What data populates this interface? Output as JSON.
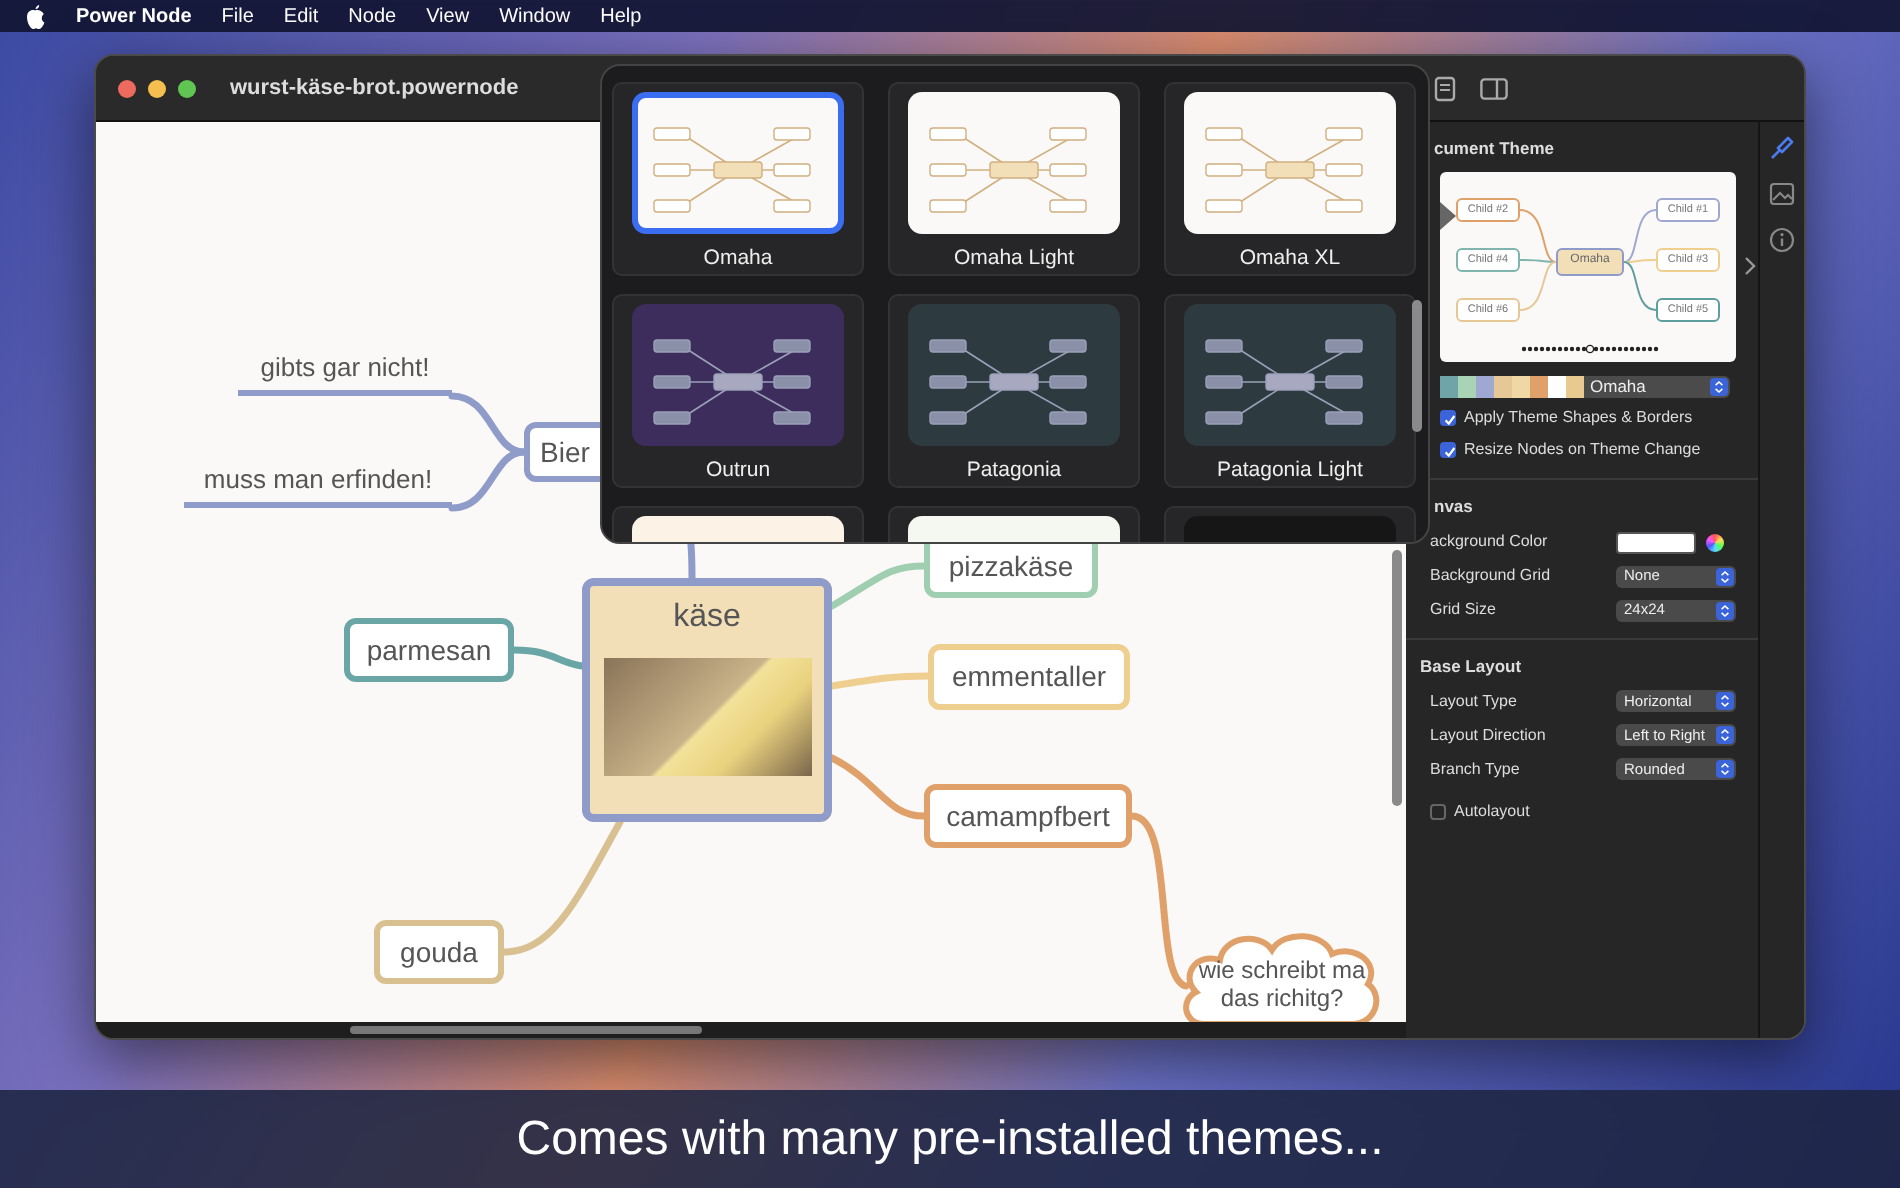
{
  "menu_bar": {
    "app": "Power Node",
    "items": [
      "File",
      "Edit",
      "Node",
      "View",
      "Window",
      "Help"
    ]
  },
  "window": {
    "title": "wurst-käse-brot.powernode"
  },
  "mind_map": {
    "nodes": [
      {
        "kind": "line",
        "text": "gibts gar nicht!",
        "color": "#8f9bc8"
      },
      {
        "kind": "line",
        "text": "muss man erfinden!",
        "color": "#8f9bc8"
      },
      {
        "kind": "box",
        "text": "Bier",
        "color": "#8f9bc8"
      },
      {
        "kind": "image",
        "text": "käse",
        "color": "#8f9bc8"
      },
      {
        "kind": "box",
        "text": "parmesan",
        "color": "#6aa6a6"
      },
      {
        "kind": "box",
        "text": "pizzakäse",
        "color": "#9fcfb0"
      },
      {
        "kind": "box",
        "text": "emmentaller",
        "color": "#efcf90"
      },
      {
        "kind": "box",
        "text": "camampfbert",
        "color": "#e0a06a"
      },
      {
        "kind": "box",
        "text": "gouda",
        "color": "#d9c090"
      },
      {
        "kind": "cloud",
        "lines": [
          "wie schreibt ma",
          "das richitg?"
        ],
        "color": "#e0a06a"
      }
    ]
  },
  "theme_picker": {
    "themes": [
      {
        "name": "Omaha",
        "selected": true,
        "color": "#fbf9f7"
      },
      {
        "name": "Omaha Light",
        "selected": false,
        "color": "#fbf9f7"
      },
      {
        "name": "Omaha XL",
        "selected": false,
        "color": "#fbf9f7"
      },
      {
        "name": "Outrun",
        "selected": false,
        "color": "#3d2d5c"
      },
      {
        "name": "Patagonia",
        "selected": false,
        "color": "#2d3b41"
      },
      {
        "name": "Patagonia Light",
        "selected": false,
        "color": "#2d3b41"
      }
    ],
    "partial_row": [
      {
        "color": "#fcf3e6"
      },
      {
        "color": "#f4f8f0"
      },
      {
        "color": "#161616"
      }
    ]
  },
  "inspector": {
    "theme": {
      "title": "cument Theme",
      "preview": {
        "center": "Omaha",
        "children": [
          {
            "text": "Child #2",
            "color": "#e0a06a"
          },
          {
            "text": "Child #1",
            "color": "#9fa8d0"
          },
          {
            "text": "Child #4",
            "color": "#7fb5ad"
          },
          {
            "text": "Child #3",
            "color": "#efcf90"
          },
          {
            "text": "Child #6",
            "color": "#e6c896"
          },
          {
            "text": "Child #5",
            "color": "#5f9e9e"
          }
        ]
      },
      "swatches": [
        {
          "color": "#6fa5a8"
        },
        {
          "color": "#a9d3b5"
        },
        {
          "color": "#9fa8d0"
        },
        {
          "color": "#e6c896"
        },
        {
          "color": "#efd7a6"
        },
        {
          "color": "#e0a06a"
        },
        {
          "color": "#ffffff"
        },
        {
          "color": "#e8c990"
        }
      ],
      "popup": "Omaha",
      "checkboxes": [
        {
          "label": "Apply Theme Shapes & Borders",
          "checked": true
        },
        {
          "label": "Resize Nodes on Theme Change",
          "checked": true
        }
      ]
    },
    "canvas": {
      "title": "nvas",
      "rows": [
        {
          "kind": "color",
          "label": "ackground Color"
        },
        {
          "kind": "popup",
          "label": "Background Grid",
          "value": "None"
        },
        {
          "kind": "popup",
          "label": "Grid Size",
          "value": "24x24"
        }
      ]
    },
    "layout": {
      "title": "Base Layout",
      "rows": [
        {
          "kind": "popup",
          "label": "Layout Type",
          "value": "Horizontal"
        },
        {
          "kind": "popup",
          "label": "Layout Direction",
          "value": "Left to Right"
        },
        {
          "kind": "popup",
          "label": "Branch Type",
          "value": "Rounded"
        },
        {
          "kind": "checkbox",
          "label": "Autolayout",
          "checked": false
        }
      ]
    }
  },
  "side_tabs": [
    {
      "kind": "brush",
      "selected": true
    },
    {
      "kind": "image",
      "selected": false
    },
    {
      "kind": "info",
      "selected": false
    }
  ],
  "caption": "Comes with many pre-installed themes..."
}
